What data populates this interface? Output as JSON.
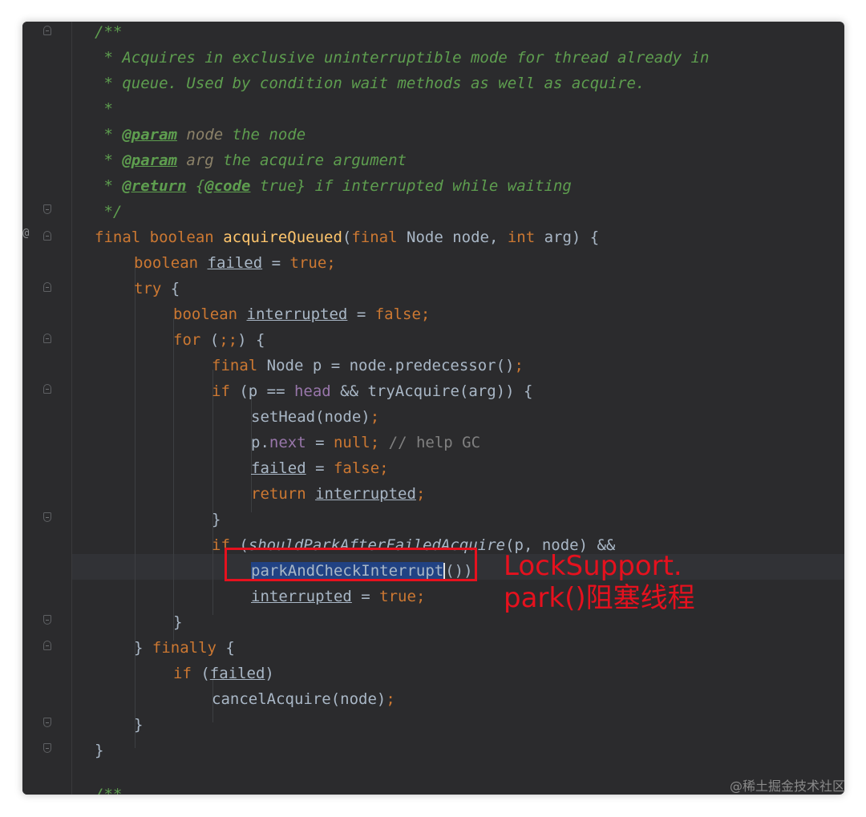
{
  "editor": {
    "code": {
      "doc_open": "/**",
      "doc_1": " * Acquires in exclusive uninterruptible mode for thread already in",
      "doc_2": " * queue. Used by condition wait methods as well as acquire.",
      "doc_3": " *",
      "tag_param": "@param",
      "tag_return": "@return",
      "tag_code": "@code",
      "p1_name": "node",
      "p1_desc": " the node",
      "p2_name": "arg",
      "p2_desc": " the acquire argument",
      "ret_desc": " true} if interrupted while waiting",
      "doc_close": " */",
      "sig_final": "final",
      "sig_boolean": "boolean",
      "sig_name": "acquireQueued",
      "sig_rest_1": "(",
      "sig_rest_2": " Node node, ",
      "sig_int": "int",
      "sig_rest_3": " arg) {",
      "failed": "failed",
      "interrupted": "interrupted",
      "true_kw": "true",
      "false_kw": "false",
      "try_kw": "try",
      "for_kw": "for",
      "if_kw": "if",
      "return_kw": "return",
      "null_kw": "null",
      "finally_kw": "finally",
      "node_p_line": " Node p = node.predecessor()",
      "head_field": "head",
      "next_field": "next",
      "try_acquire": " && tryAcquire(arg)) {",
      "set_head": "setHead(node)",
      "help_gc": "// help GC",
      "should_park": "shouldParkAfterFailedAcquire",
      "should_park_args": "(p, node) &&",
      "park_call": "parkAndCheckInterrupt",
      "cancel_acquire": "cancelAcquire(node)",
      "next_doc": "/**"
    },
    "gutter_marker": "@"
  },
  "annotation": {
    "line1": "LockSupport.",
    "line2": "park()阻塞线程"
  },
  "watermark": "@稀土掘金技术社区"
}
